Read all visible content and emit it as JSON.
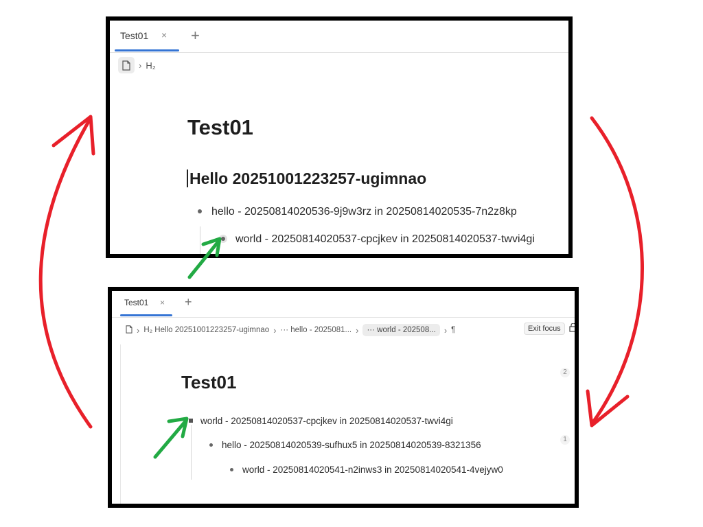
{
  "top_panel": {
    "tab_label": "Test01",
    "tab_close": "×",
    "tab_add": "+",
    "crumb_heading": "H₂",
    "doc_title": "Test01",
    "heading": "Hello 20251001223257-ugimnao",
    "item1": "hello - 20250814020536-9j9w3rz in 20250814020535-7n2z8kp",
    "item2": "world - 20250814020537-cpcjkev in 20250814020537-twvi4gi"
  },
  "bottom_panel": {
    "tab_label": "Test01",
    "tab_close": "×",
    "tab_add": "+",
    "crumb_heading": "H₂ Hello 20251001223257-ugimnao",
    "crumb_hello": "··· hello - 2025081...",
    "crumb_world": "··· world - 202508...",
    "crumb_para": "¶",
    "exit_focus": "Exit focus",
    "doc_title": "Test01",
    "item1": "world - 20250814020537-cpcjkev in 20250814020537-twvi4gi",
    "item2": "hello - 20250814020539-sufhux5 in 20250814020539-8321356",
    "item3": "world - 20250814020541-n2inws3 in 20250814020541-4vejyw0",
    "count_a": "2",
    "count_b": "1"
  },
  "colors": {
    "red_arrow": "#e8202a",
    "green_arrow": "#22aa44",
    "tab_accent": "#3574d4"
  },
  "icons": [
    "document-icon",
    "chevron-right-icon",
    "close-icon",
    "plus-icon",
    "lock-icon"
  ]
}
